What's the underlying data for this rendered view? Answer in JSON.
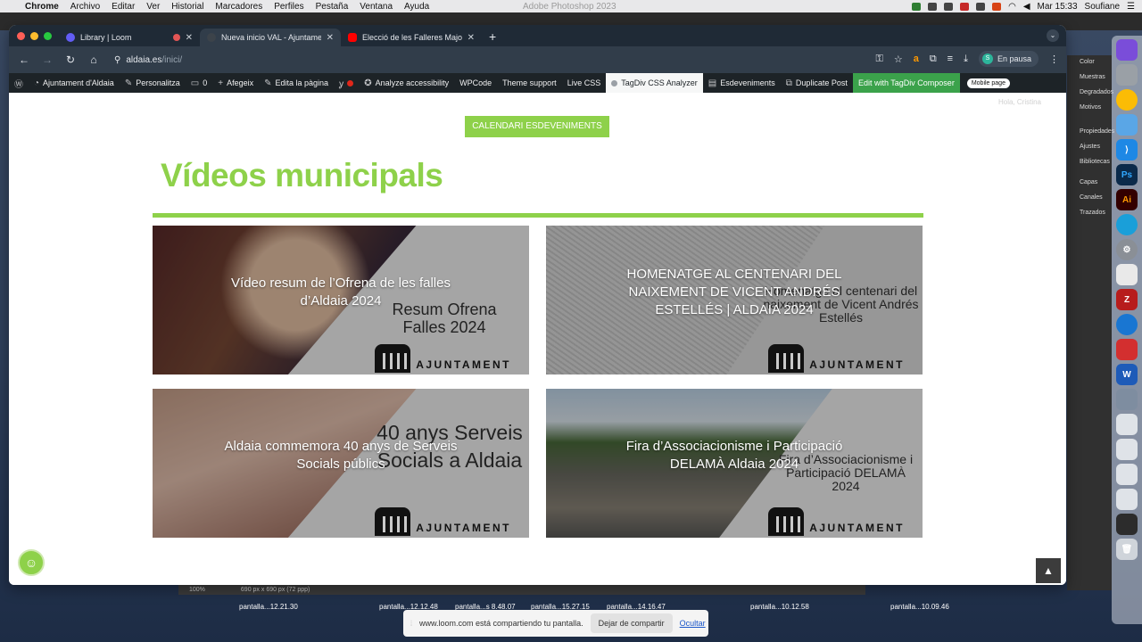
{
  "menubar": {
    "app": "Chrome",
    "items": [
      "Archivo",
      "Editar",
      "Ver",
      "Historial",
      "Marcadores",
      "Perfiles",
      "Pestaña",
      "Ventana",
      "Ayuda"
    ],
    "center_title": "Adobe Photoshop 2023",
    "clock": "Mar 15:33",
    "user": "Soufiane"
  },
  "photoshop": {
    "panels": [
      "Color",
      "Muestras",
      "Degradados",
      "Motivos",
      "Propiedades",
      "Ajustes",
      "Bibliotecas",
      "Capas",
      "Canales",
      "Trazados"
    ],
    "zoom": "100%",
    "doc_info": "690 px x 690 px (72 ppp)"
  },
  "browser": {
    "tabs": [
      {
        "title": "Library | Loom",
        "favicon_color": "#625df5",
        "active": false
      },
      {
        "title": "Nueva inicio VAL - Ajuntament",
        "favicon_color": "#1d2327",
        "active": true
      },
      {
        "title": "Elecció de les Falleres Majors",
        "favicon_color": "#ff0000",
        "active": false
      }
    ],
    "url_host": "aldaia.es",
    "url_path": "/inici/",
    "profile_label": "En pausa",
    "profile_initial": "S"
  },
  "wpbar": {
    "site": "Ajuntament d'Aldaia",
    "customize": "Personalitza",
    "comments": "0",
    "new": "Afegeix",
    "edit": "Edita la pàgina",
    "accessibility": "Analyze accessibility",
    "wpcode": "WPCode",
    "theme_support": "Theme support",
    "live_css": "Live CSS",
    "tagdiv_css": "TagDiv CSS Analyzer",
    "events": "Esdeveniments",
    "duplicate": "Duplicate Post",
    "composer": "Edit with TagDiv Composer",
    "mobile": "Mobile page"
  },
  "page": {
    "howdy": "Hola, Cristina",
    "calendar_button": "CALENDARI ESDEVENIMENTS",
    "section_title": "Vídeos municipals",
    "accent": "#8ed14a",
    "videos": [
      {
        "title": "Vídeo resum de l’Ofrena de les falles d’Aldaia 2024",
        "thumb_text": "Resum Ofrena Falles 2024",
        "crest_word": "AJUNTAMENT"
      },
      {
        "title": "HOMENATGE AL CENTENARI DEL NAIXEMENT DE VICENT ANDRÉS ESTELLÉS | ALDAIA 2024",
        "thumb_text": "Homenatge al centenari del naixement de Vicent Andrés Estellés",
        "crest_word": "AJUNTAMENT"
      },
      {
        "title": "Aldaia commemora 40 anys de Serveis Socials públics",
        "thumb_text": "40 anys Serveis Socials a Aldaia",
        "crest_word": "AJUNTAMENT"
      },
      {
        "title": "Fira d’Associacionisme i Participació DELAMÀ Aldaia 2024",
        "thumb_text": "Fira d’Associacionisme i Participació DELAMÀ 2024",
        "crest_word": "AJUNTAMENT"
      }
    ]
  },
  "desktop_files": [
    "pantalla...12.21.30",
    "pantalla...12.12.48",
    "pantalla...s 8.48.07",
    "pantalla...15.27.15",
    "pantalla...14.16.47",
    "pantalla...10.12.58",
    "pantalla...10.09.46"
  ],
  "share_bar": {
    "message": "www.loom.com está compartiendo tu pantalla.",
    "stop": "Dejar de compartir",
    "hide": "Ocultar"
  }
}
